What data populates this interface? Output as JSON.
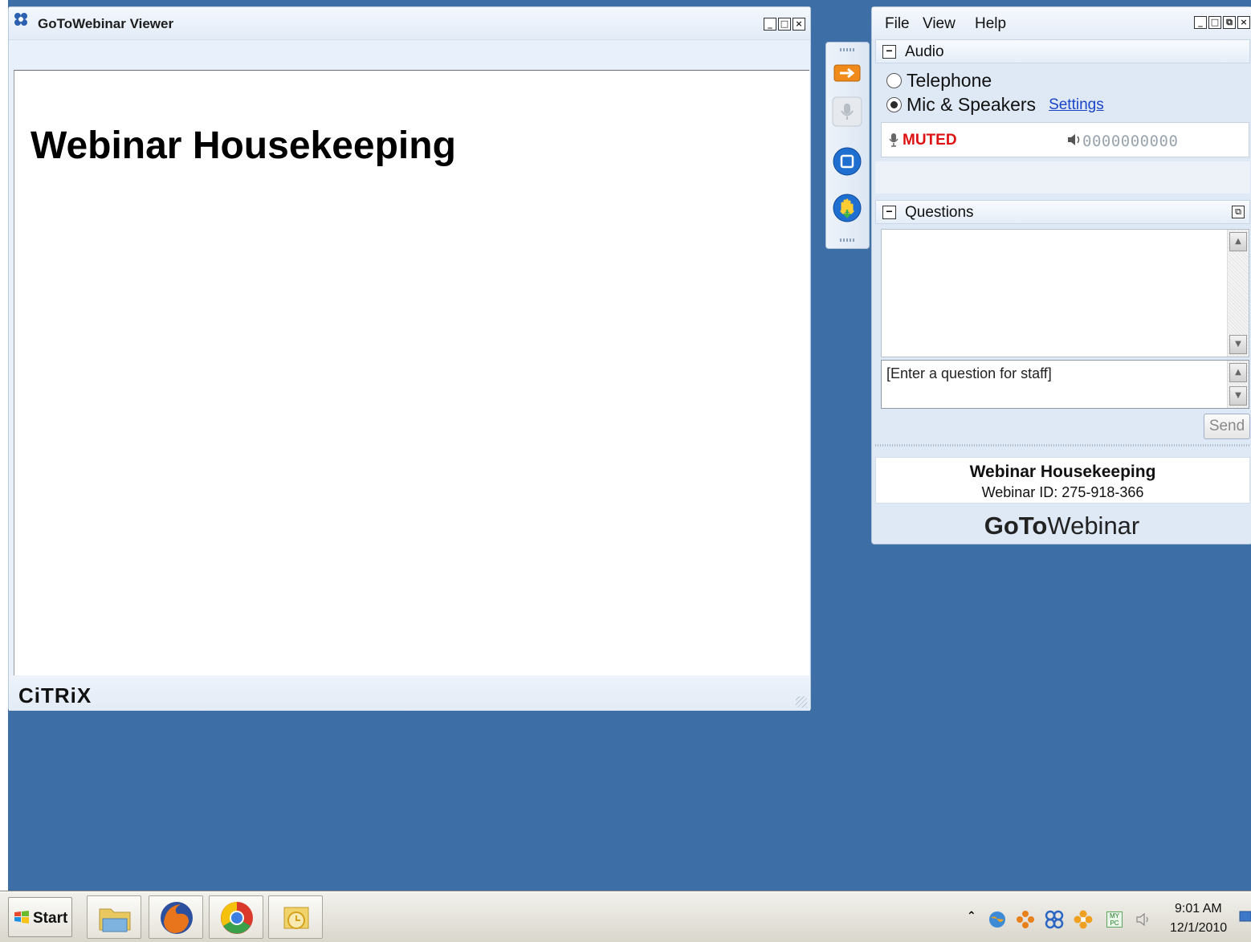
{
  "viewer": {
    "title": "GoToWebinar Viewer",
    "window_buttons": [
      "_",
      "□",
      "×"
    ],
    "slide_title": "Webinar Housekeeping",
    "footer_logo": "CiTRiX"
  },
  "panel": {
    "menu": [
      "File",
      "View",
      "Help"
    ],
    "window_buttons": [
      "_",
      "□",
      "⧉",
      "×"
    ],
    "audio": {
      "section_title": "Audio",
      "collapse_symbol": "−",
      "options": [
        "Telephone",
        "Mic & Speakers"
      ],
      "selected": "Mic & Speakers",
      "settings_link": "Settings",
      "mic_status": "MUTED",
      "speaker_level_text": "0000000000"
    },
    "questions": {
      "section_title": "Questions",
      "collapse_symbol": "−",
      "popout_symbol": "⧉",
      "input_placeholder": "[Enter a question for staff]",
      "send_label": "Send"
    },
    "info": {
      "webinar_title": "Webinar Housekeeping",
      "webinar_id": "Webinar ID: 275-918-366"
    },
    "brand": {
      "bold": "GoTo",
      "regular": "Webinar"
    }
  },
  "grab_tab": {
    "icons": [
      "show-hide-arrow-icon",
      "microphone-icon",
      "screen-icon",
      "raise-hand-icon"
    ],
    "colors": {
      "arrow": "#f08a1a",
      "blue": "#1f6fd1"
    }
  },
  "taskbar": {
    "start_label": "Start",
    "pinned": [
      "windows-explorer-icon",
      "firefox-icon",
      "chrome-icon",
      "outlook-icon"
    ],
    "tray_icons": [
      "show-hidden-icons-icon",
      "network-globe-icon",
      "gotomeeting-flower-icon",
      "butterfly-icon",
      "gotowebinar-flower-icon",
      "mypc-icon",
      "volume-icon"
    ],
    "mypc_text": "MY PC",
    "time": "9:01 AM",
    "date": "12/1/2010"
  },
  "colors": {
    "desktop": "#3d6ea5",
    "muted": "#dd1111",
    "link": "#1a44c8"
  }
}
